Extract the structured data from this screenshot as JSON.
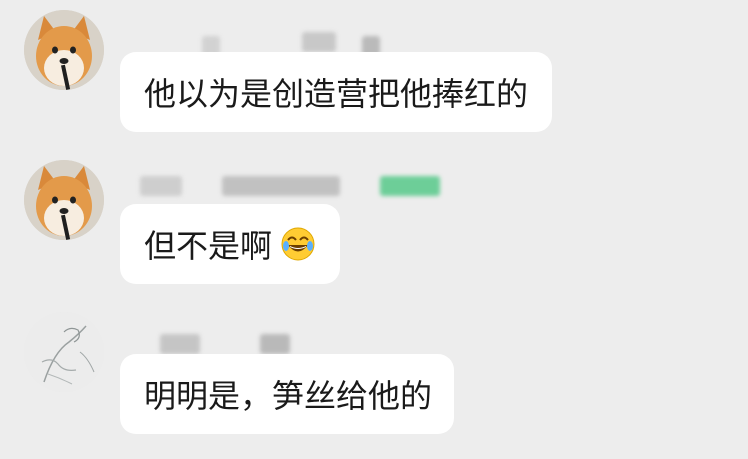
{
  "chat": {
    "messages": [
      {
        "avatar": "shiba-dog-avatar",
        "text": "他以为是创造营把他捧红的"
      },
      {
        "avatar": "shiba-dog-avatar",
        "text": "但不是啊",
        "emoji": "tears-of-joy-emoji"
      },
      {
        "avatar": "sketch-figure-avatar",
        "text": "明明是，笋丝给他的"
      }
    ]
  },
  "colors": {
    "background": "#ededed",
    "bubble": "#ffffff",
    "text": "#1a1a1a",
    "redacted_green": "#57c98a"
  }
}
